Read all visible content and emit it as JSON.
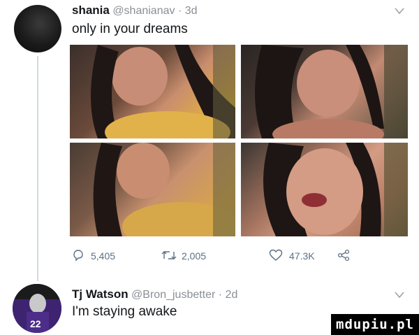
{
  "tweet1": {
    "name": "shania",
    "handle_time": "@shanianav · 3d",
    "text": "only in your dreams",
    "actions": {
      "replies": "5,405",
      "retweets": "2,005",
      "likes": "47.3K"
    }
  },
  "tweet2": {
    "name": "Tj Watson",
    "handle_time": "@Bron_jusbetter · 2d",
    "text": "I'm staying awake"
  },
  "watermark": "mdupiu.pl",
  "icons": {
    "chevron": "chevron-down-icon",
    "reply": "reply-icon",
    "retweet": "retweet-icon",
    "like": "heart-icon",
    "share": "share-icon"
  }
}
